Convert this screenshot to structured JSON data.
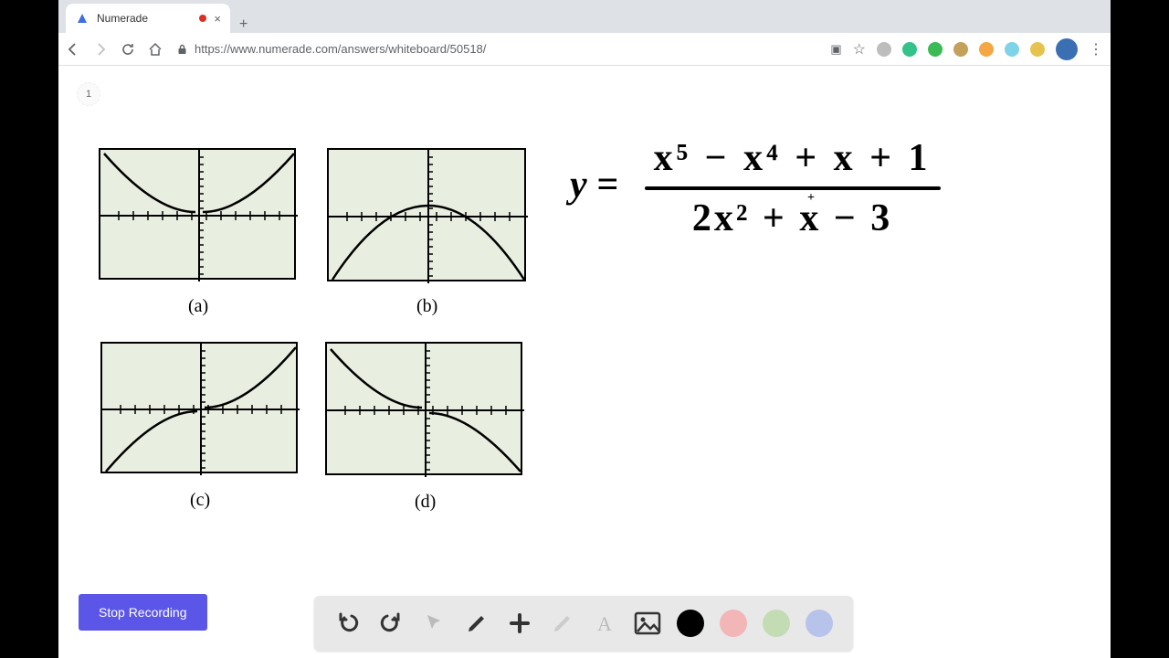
{
  "browser": {
    "tab_title": "Numerade",
    "url": "https://www.numerade.com/answers/whiteboard/50518/",
    "page_badge": "1"
  },
  "graphs": {
    "a": "(a)",
    "b": "(b)",
    "c": "(c)",
    "d": "(d)"
  },
  "equation": {
    "lhs": "y =",
    "numerator": "x⁵ − x⁴ + x + 1",
    "denominator": "2x² + x − 3"
  },
  "controls": {
    "stop_label": "Stop Recording"
  },
  "swatches": {
    "black": "#000000",
    "pink": "#f2b6b6",
    "green": "#c4dcb4",
    "blue": "#b8c3ec"
  }
}
